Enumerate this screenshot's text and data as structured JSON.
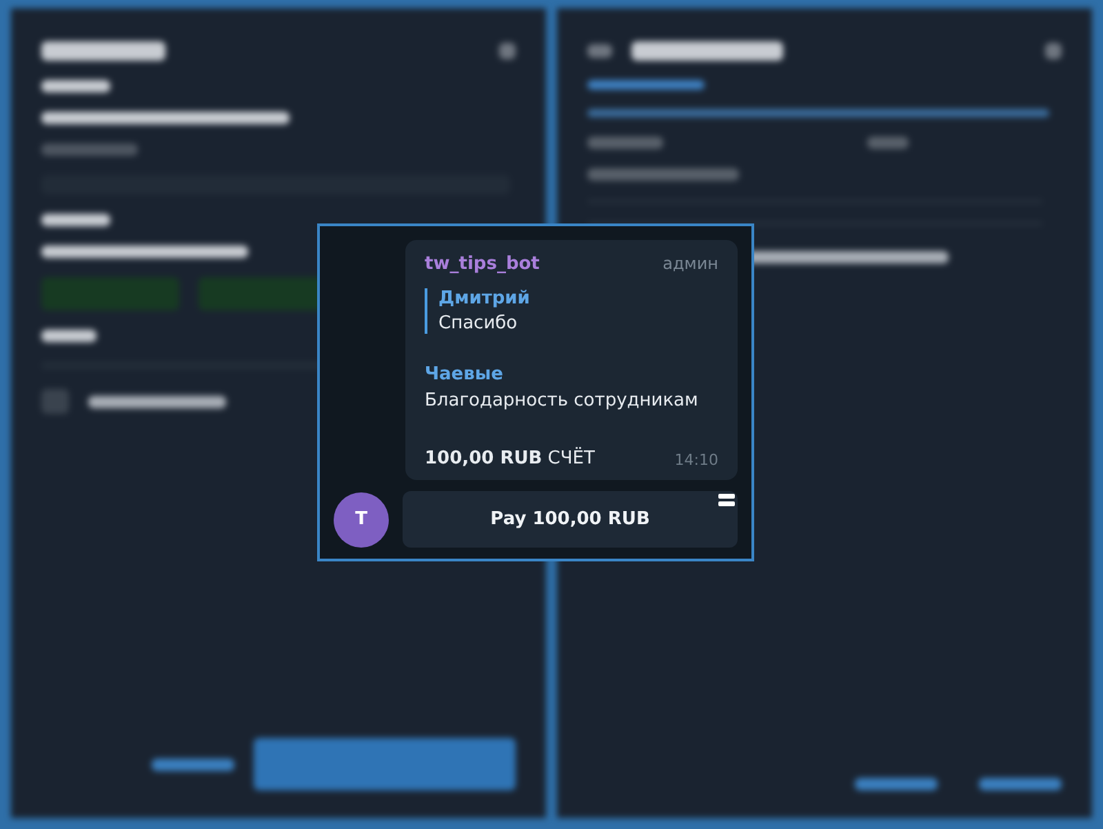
{
  "message": {
    "sender": "tw_tips_bot",
    "badge": "админ",
    "reply": {
      "author": "Дмитрий",
      "text": "Спасибо"
    },
    "invoice": {
      "title": "Чаевые",
      "description": "Благодарность сотрудникам",
      "amount": "**100,00 RUB** СЧЁТ"
    },
    "time": "14:10"
  },
  "avatar": {
    "initial": "T"
  },
  "buttons": [
    {
      "label": "Pay 100,00 RUB"
    }
  ]
}
